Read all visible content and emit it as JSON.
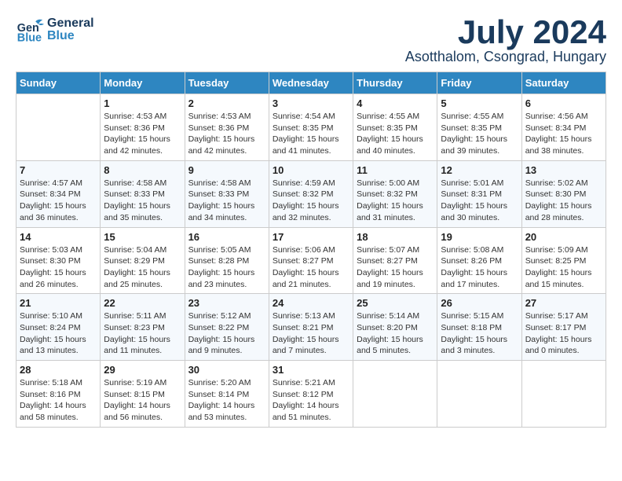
{
  "header": {
    "logo_general": "General",
    "logo_blue": "Blue",
    "month_title": "July 2024",
    "location": "Asotthalom, Csongrad, Hungary"
  },
  "days_of_week": [
    "Sunday",
    "Monday",
    "Tuesday",
    "Wednesday",
    "Thursday",
    "Friday",
    "Saturday"
  ],
  "weeks": [
    [
      {
        "day": "",
        "info": ""
      },
      {
        "day": "1",
        "info": "Sunrise: 4:53 AM\nSunset: 8:36 PM\nDaylight: 15 hours\nand 42 minutes."
      },
      {
        "day": "2",
        "info": "Sunrise: 4:53 AM\nSunset: 8:36 PM\nDaylight: 15 hours\nand 42 minutes."
      },
      {
        "day": "3",
        "info": "Sunrise: 4:54 AM\nSunset: 8:35 PM\nDaylight: 15 hours\nand 41 minutes."
      },
      {
        "day": "4",
        "info": "Sunrise: 4:55 AM\nSunset: 8:35 PM\nDaylight: 15 hours\nand 40 minutes."
      },
      {
        "day": "5",
        "info": "Sunrise: 4:55 AM\nSunset: 8:35 PM\nDaylight: 15 hours\nand 39 minutes."
      },
      {
        "day": "6",
        "info": "Sunrise: 4:56 AM\nSunset: 8:34 PM\nDaylight: 15 hours\nand 38 minutes."
      }
    ],
    [
      {
        "day": "7",
        "info": "Sunrise: 4:57 AM\nSunset: 8:34 PM\nDaylight: 15 hours\nand 36 minutes."
      },
      {
        "day": "8",
        "info": "Sunrise: 4:58 AM\nSunset: 8:33 PM\nDaylight: 15 hours\nand 35 minutes."
      },
      {
        "day": "9",
        "info": "Sunrise: 4:58 AM\nSunset: 8:33 PM\nDaylight: 15 hours\nand 34 minutes."
      },
      {
        "day": "10",
        "info": "Sunrise: 4:59 AM\nSunset: 8:32 PM\nDaylight: 15 hours\nand 32 minutes."
      },
      {
        "day": "11",
        "info": "Sunrise: 5:00 AM\nSunset: 8:32 PM\nDaylight: 15 hours\nand 31 minutes."
      },
      {
        "day": "12",
        "info": "Sunrise: 5:01 AM\nSunset: 8:31 PM\nDaylight: 15 hours\nand 30 minutes."
      },
      {
        "day": "13",
        "info": "Sunrise: 5:02 AM\nSunset: 8:30 PM\nDaylight: 15 hours\nand 28 minutes."
      }
    ],
    [
      {
        "day": "14",
        "info": "Sunrise: 5:03 AM\nSunset: 8:30 PM\nDaylight: 15 hours\nand 26 minutes."
      },
      {
        "day": "15",
        "info": "Sunrise: 5:04 AM\nSunset: 8:29 PM\nDaylight: 15 hours\nand 25 minutes."
      },
      {
        "day": "16",
        "info": "Sunrise: 5:05 AM\nSunset: 8:28 PM\nDaylight: 15 hours\nand 23 minutes."
      },
      {
        "day": "17",
        "info": "Sunrise: 5:06 AM\nSunset: 8:27 PM\nDaylight: 15 hours\nand 21 minutes."
      },
      {
        "day": "18",
        "info": "Sunrise: 5:07 AM\nSunset: 8:27 PM\nDaylight: 15 hours\nand 19 minutes."
      },
      {
        "day": "19",
        "info": "Sunrise: 5:08 AM\nSunset: 8:26 PM\nDaylight: 15 hours\nand 17 minutes."
      },
      {
        "day": "20",
        "info": "Sunrise: 5:09 AM\nSunset: 8:25 PM\nDaylight: 15 hours\nand 15 minutes."
      }
    ],
    [
      {
        "day": "21",
        "info": "Sunrise: 5:10 AM\nSunset: 8:24 PM\nDaylight: 15 hours\nand 13 minutes."
      },
      {
        "day": "22",
        "info": "Sunrise: 5:11 AM\nSunset: 8:23 PM\nDaylight: 15 hours\nand 11 minutes."
      },
      {
        "day": "23",
        "info": "Sunrise: 5:12 AM\nSunset: 8:22 PM\nDaylight: 15 hours\nand 9 minutes."
      },
      {
        "day": "24",
        "info": "Sunrise: 5:13 AM\nSunset: 8:21 PM\nDaylight: 15 hours\nand 7 minutes."
      },
      {
        "day": "25",
        "info": "Sunrise: 5:14 AM\nSunset: 8:20 PM\nDaylight: 15 hours\nand 5 minutes."
      },
      {
        "day": "26",
        "info": "Sunrise: 5:15 AM\nSunset: 8:18 PM\nDaylight: 15 hours\nand 3 minutes."
      },
      {
        "day": "27",
        "info": "Sunrise: 5:17 AM\nSunset: 8:17 PM\nDaylight: 15 hours\nand 0 minutes."
      }
    ],
    [
      {
        "day": "28",
        "info": "Sunrise: 5:18 AM\nSunset: 8:16 PM\nDaylight: 14 hours\nand 58 minutes."
      },
      {
        "day": "29",
        "info": "Sunrise: 5:19 AM\nSunset: 8:15 PM\nDaylight: 14 hours\nand 56 minutes."
      },
      {
        "day": "30",
        "info": "Sunrise: 5:20 AM\nSunset: 8:14 PM\nDaylight: 14 hours\nand 53 minutes."
      },
      {
        "day": "31",
        "info": "Sunrise: 5:21 AM\nSunset: 8:12 PM\nDaylight: 14 hours\nand 51 minutes."
      },
      {
        "day": "",
        "info": ""
      },
      {
        "day": "",
        "info": ""
      },
      {
        "day": "",
        "info": ""
      }
    ]
  ]
}
